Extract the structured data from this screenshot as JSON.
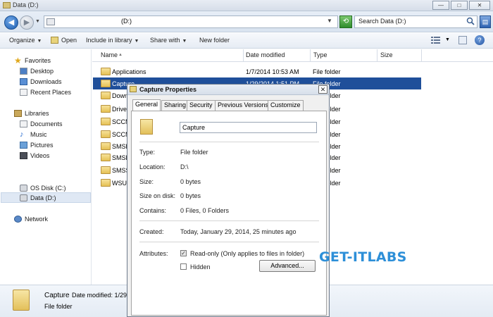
{
  "window": {
    "title": "Data (D:)",
    "minimize_icon": "minimize-icon",
    "maximize_icon": "maximize-icon",
    "close_icon": "close-icon"
  },
  "address": {
    "path": "(D:)",
    "search_placeholder": "Search Data (D:)"
  },
  "toolbar": {
    "organize": "Organize",
    "open": "Open",
    "include_in_library": "Include in library",
    "share_with": "Share with",
    "new_folder": "New folder"
  },
  "nav": {
    "favorites": "Favorites",
    "favorites_items": [
      "Desktop",
      "Downloads",
      "Recent Places"
    ],
    "libraries": "Libraries",
    "libraries_items": [
      "Documents",
      "Music",
      "Pictures",
      "Videos"
    ],
    "computer_items": [
      "OS Disk (C:)",
      "Data (D:)"
    ],
    "network": "Network"
  },
  "columns": {
    "name": "Name",
    "date_modified": "Date modified",
    "type": "Type",
    "size": "Size"
  },
  "files": [
    {
      "name": "Applications",
      "date": "1/7/2014 10:53 AM",
      "type": "File folder"
    },
    {
      "name": "Capture",
      "date": "1/29/2014 1:51 PM",
      "type": "File folder",
      "selected": true
    },
    {
      "name": "Downloads",
      "date": "",
      "type": "File folder"
    },
    {
      "name": "Drivers",
      "date": "",
      "type": "File folder"
    },
    {
      "name": "SCCM",
      "date": "",
      "type": "File folder"
    },
    {
      "name": "SCCM",
      "date": "",
      "type": "File folder"
    },
    {
      "name": "SMSP",
      "date": "",
      "type": "File folder"
    },
    {
      "name": "SMSP",
      "date": "",
      "type": "File folder"
    },
    {
      "name": "SMSS",
      "date": "",
      "type": "File folder"
    },
    {
      "name": "WSUS",
      "date": "",
      "type": "File folder"
    }
  ],
  "details": {
    "name": "Capture",
    "date_label": "Date modified: 1/29",
    "type": "File folder"
  },
  "dialog": {
    "title": "Capture Properties",
    "close_label": "✕",
    "tabs": [
      "General",
      "Sharing",
      "Security",
      "Previous Versions",
      "Customize"
    ],
    "name_value": "Capture",
    "type_label": "Type:",
    "type_value": "File folder",
    "location_label": "Location:",
    "location_value": "D:\\",
    "size_label": "Size:",
    "size_value": "0 bytes",
    "size_on_disk_label": "Size on disk:",
    "size_on_disk_value": "0 bytes",
    "contains_label": "Contains:",
    "contains_value": "0 Files, 0 Folders",
    "created_label": "Created:",
    "created_value": "Today, January 29, 2014, 25 minutes ago",
    "attributes_label": "Attributes:",
    "readonly_label": "Read-only (Only applies to files in folder)",
    "hidden_label": "Hidden",
    "advanced_button": "Advanced..."
  },
  "watermark": "GET-ITLABS",
  "colors": {
    "accent": "#1f4f9a",
    "watermark": "#2d8fd8"
  }
}
